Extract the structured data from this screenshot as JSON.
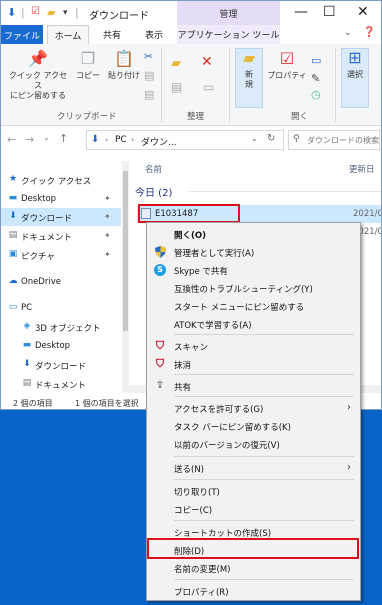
{
  "window": {
    "title": "ダウンロード",
    "context_tab": "管理",
    "controls": {
      "minimize": "—",
      "maximize": "☐",
      "close": "✕"
    }
  },
  "ribbon_tabs": {
    "file": "ファイル",
    "home": "ホーム",
    "share": "共有",
    "view": "表示",
    "app_tools": "アプリケーション ツール"
  },
  "ribbon": {
    "quick_access_label_1": "クイック アクセス",
    "quick_access_label_2": "にピン留めする",
    "copy": "コピー",
    "paste": "貼り付け",
    "clipboard_group": "クリップボード",
    "organize_group": "整理",
    "new_1": "新",
    "new_2": "規",
    "properties": "プロパティ",
    "open_group": "開く",
    "select": "選択"
  },
  "address": {
    "path_pc": "PC",
    "path_dir": "ダウン...",
    "search_placeholder": "ダウンロードの検索"
  },
  "nav": {
    "quick_access": "クイック アクセス",
    "desktop": "Desktop",
    "downloads": "ダウンロード",
    "documents": "ドキュメント",
    "pictures": "ピクチャ",
    "onedrive": "OneDrive",
    "pc": "PC",
    "objects3d": "3D オブジェクト",
    "desktop2": "Desktop",
    "downloads2": "ダウンロード",
    "documents2": "ドキュメント"
  },
  "content": {
    "col_name": "名前",
    "col_date": "更新日",
    "group_today": "今日 (2)",
    "file1_name": "E1031487",
    "file1_date": "2021/0",
    "file2_date": "2021/0"
  },
  "status": {
    "items": "2 個の項目",
    "selected": "1 個の項目を選択"
  },
  "context_menu": {
    "open": "開く(O)",
    "run_as_admin": "管理者として実行(A)",
    "skype_share": "Skype で共有",
    "troubleshoot": "互換性のトラブルシューティング(Y)",
    "pin_start": "スタート メニューにピン留めする",
    "atok_learn": "ATOKで学習する(A)",
    "scan": "スキャン",
    "erase": "抹消",
    "share": "共有",
    "grant_access": "アクセスを許可する(G)",
    "pin_taskbar": "タスク バーにピン留めする(K)",
    "restore_prev": "以前のバージョンの復元(V)",
    "send_to": "送る(N)",
    "cut": "切り取り(T)",
    "copy": "コピー(C)",
    "create_shortcut": "ショートカットの作成(S)",
    "delete": "削除(D)",
    "rename": "名前の変更(M)",
    "properties": "プロパティ(R)"
  },
  "colors": {
    "accent": "#1a6bd1",
    "highlight_border": "#d8111a",
    "selection": "#cce8ff",
    "desktop": "#0a64c8"
  }
}
